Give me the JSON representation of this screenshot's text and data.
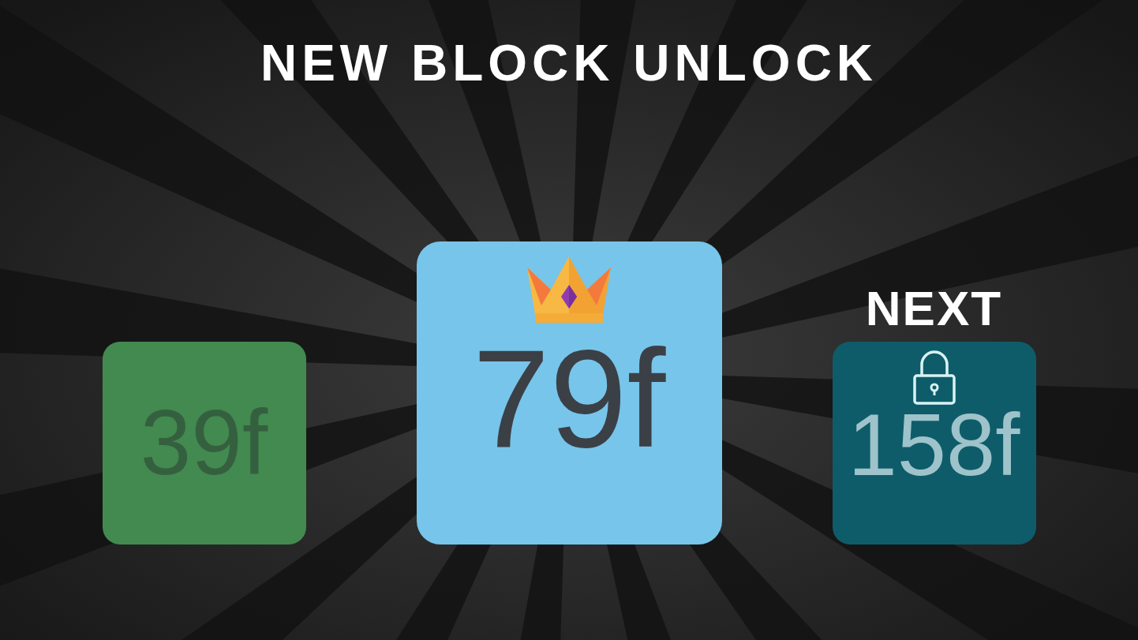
{
  "title": "NEW BLOCK UNLOCK",
  "blocks": [
    {
      "kind": "unlocked",
      "value": "39f",
      "color": "#428a4f"
    },
    {
      "kind": "new",
      "value": "79f",
      "color": "#77c5ea"
    },
    {
      "kind": "locked",
      "caption": "NEXT",
      "value": "158f",
      "color": "#0e5c69"
    }
  ]
}
